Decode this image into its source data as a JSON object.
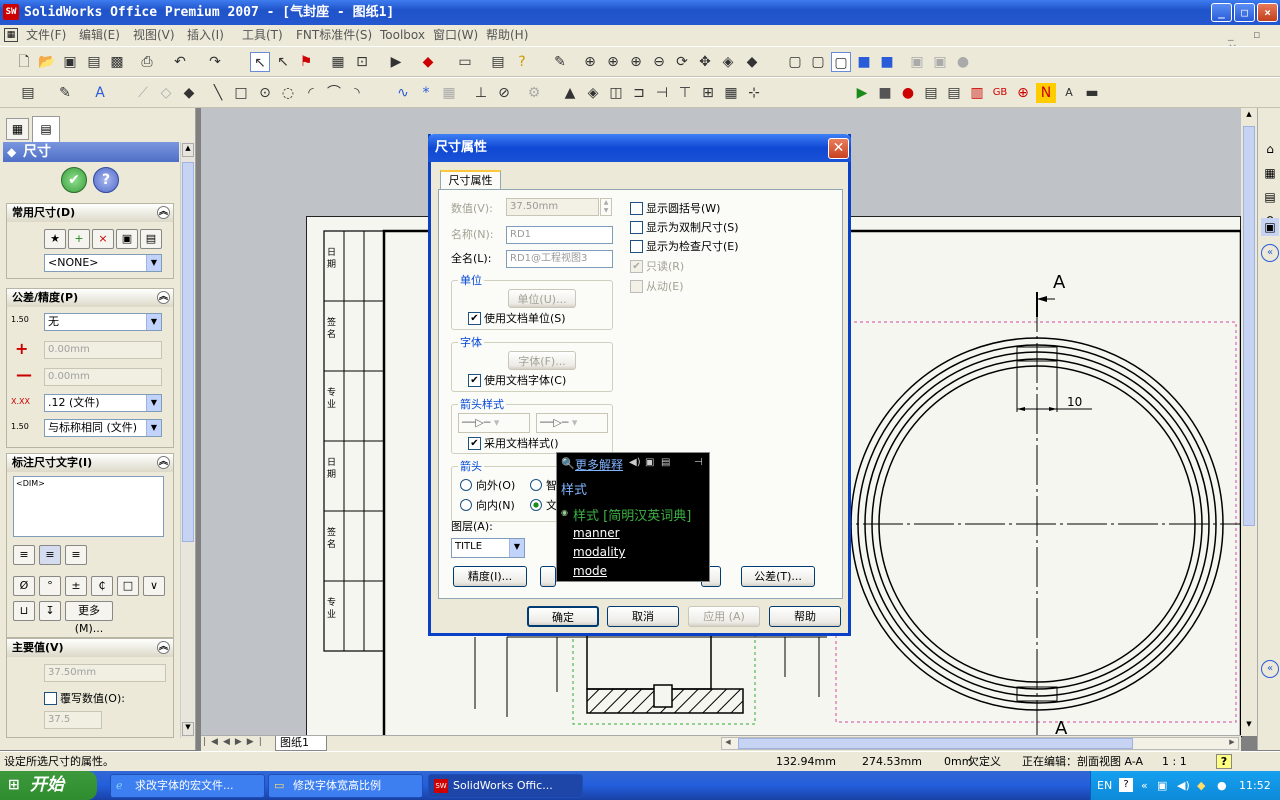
{
  "window": {
    "title": "SolidWorks Office Premium 2007 - [气封座 - 图纸1]",
    "minimize": "_",
    "maximize": "□",
    "close": "×"
  },
  "menubar": {
    "items": [
      "文件(F)",
      "编辑(E)",
      "视图(V)",
      "插入(I)",
      "工具(T)",
      "FNT标准件(S)",
      "Toolbox",
      "窗口(W)",
      "帮助(H)"
    ]
  },
  "left_panel": {
    "title": "尺寸",
    "ok": "✔",
    "help": "?",
    "common_dims": {
      "header": "常用尺寸(D)",
      "select_value": "<NONE>"
    },
    "tolerance": {
      "header": "公差/精度(P)",
      "type": "无",
      "plus": "0.00mm",
      "minus": "0.00mm",
      "precision": ".12 (文件)",
      "tol_precision": "与标称相同 (文件)",
      "icon_label": "1.50"
    },
    "dim_text": {
      "header": "标注尺寸文字(I)",
      "text": "<DIM>",
      "more_button": "更多(M)..."
    },
    "primary": {
      "header": "主要值(V)",
      "value": "37.50mm",
      "override_label": "覆写数值(O):",
      "override_value": "37.5"
    }
  },
  "dialog": {
    "title": "尺寸属性",
    "tab": "尺寸属性",
    "value_label": "数值(V):",
    "value": "37.50mm",
    "name_label": "名称(N):",
    "name": "RD1",
    "fullname_label": "全名(L):",
    "fullname": "RD1@工程视图3",
    "checks": [
      {
        "label": "显示圆括号(W)",
        "checked": false,
        "disabled": false
      },
      {
        "label": "显示为双制尺寸(S)",
        "checked": false,
        "disabled": false
      },
      {
        "label": "显示为检查尺寸(E)",
        "checked": false,
        "disabled": false
      },
      {
        "label": "只读(R)",
        "checked": true,
        "disabled": true
      },
      {
        "label": "从动(E)",
        "checked": false,
        "disabled": true
      }
    ],
    "unit": {
      "legend": "单位",
      "button": "单位(U)...",
      "check": "使用文档单位(S)"
    },
    "font": {
      "legend": "字体",
      "button": "字体(F)...",
      "check": "使用文档字体(C)"
    },
    "arrow_style": {
      "legend": "箭头样式",
      "check": "采用文档样式()"
    },
    "arrows": {
      "legend": "箭头",
      "outside": "向外(O)",
      "inside": "向内(N)",
      "smart": "智",
      "doc": "文"
    },
    "layer_label": "图层(A):",
    "layer": "TITLE",
    "precision_button": "精度(I)...",
    "tolerance_button": "公差(T)...",
    "ok": "确定",
    "cancel": "取消",
    "apply": "应用 (A)",
    "help": "帮助"
  },
  "popup": {
    "more": "更多解释",
    "word": "样式",
    "dict": "样式 [简明汉英词典]",
    "translations": [
      "manner",
      "modality",
      "mode"
    ]
  },
  "drawing": {
    "sheet_tab": "图纸1",
    "section_label_top": "A",
    "section_label_bottom": "A",
    "dim_10": "10",
    "title_block_cells": [
      "日期",
      "签名",
      "专业",
      "日期",
      "签名",
      "专业"
    ]
  },
  "statusbar": {
    "message": "设定所选尺寸的属性。",
    "x": "132.94mm",
    "y": "274.53mm",
    "z": "0mm",
    "state": "欠定义",
    "editing": "正在编辑：剖面视图 A-A",
    "scale": "1 : 1",
    "help": "?"
  },
  "taskbar": {
    "start": "开始",
    "tasks": [
      "求改字体的宏文件...",
      "修改字体宽高比例",
      "SolidWorks Offic..."
    ],
    "lang": "EN",
    "clock": "11:52"
  }
}
